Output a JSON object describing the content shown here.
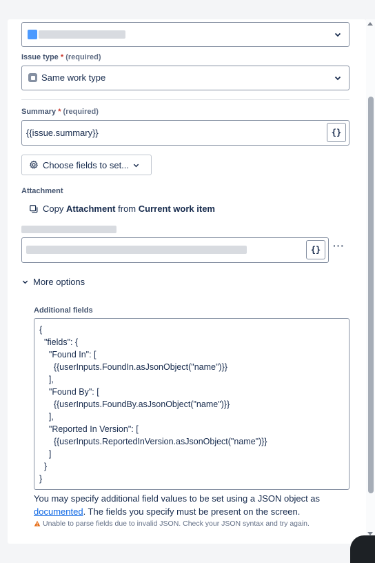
{
  "project_select": {
    "value_redacted": true
  },
  "issue_type": {
    "label": "Issue type",
    "required_mark": "*",
    "required_text": "(required)",
    "value": "Same work type"
  },
  "summary": {
    "label": "Summary",
    "required_mark": "*",
    "required_text": "(required)",
    "value": "{{issue.summary}}",
    "smart_value_button": "{}"
  },
  "choose_fields_button": "Choose fields to set...",
  "attachment": {
    "label": "Attachment",
    "copy_prefix": "Copy",
    "copy_bold1": "Attachment",
    "copy_mid": "from",
    "copy_bold2": "Current work item"
  },
  "redacted_field": {
    "smart_value_button": "{}",
    "more_button": "···"
  },
  "more_options_label": "More options",
  "additional_fields": {
    "label": "Additional fields",
    "json_lines": [
      "{",
      "  \"fields\": {",
      "    \"Found In\": [",
      "      {{userInputs.FoundIn.asJsonObject(\"name\")}}",
      "    ],",
      "    \"Found By\": [",
      "      {{userInputs.FoundBy.asJsonObject(\"name\")}}",
      "    ],",
      "    \"Reported In Version\": [",
      "      {{userInputs.ReportedInVersion.asJsonObject(\"name\")}}",
      "    ]",
      "  }",
      "}"
    ],
    "help_text_before": "You may specify additional field values to be set using a JSON object as",
    "help_link": "documented",
    "help_text_after": ". The fields you specify must be present on the screen.",
    "warning_text": "Unable to parse fields due to invalid JSON. Check your JSON syntax and try again."
  },
  "colors": {
    "required": "#c9372c",
    "link": "#0c66e4",
    "warning": "#e56910",
    "border": "#8590a2"
  }
}
